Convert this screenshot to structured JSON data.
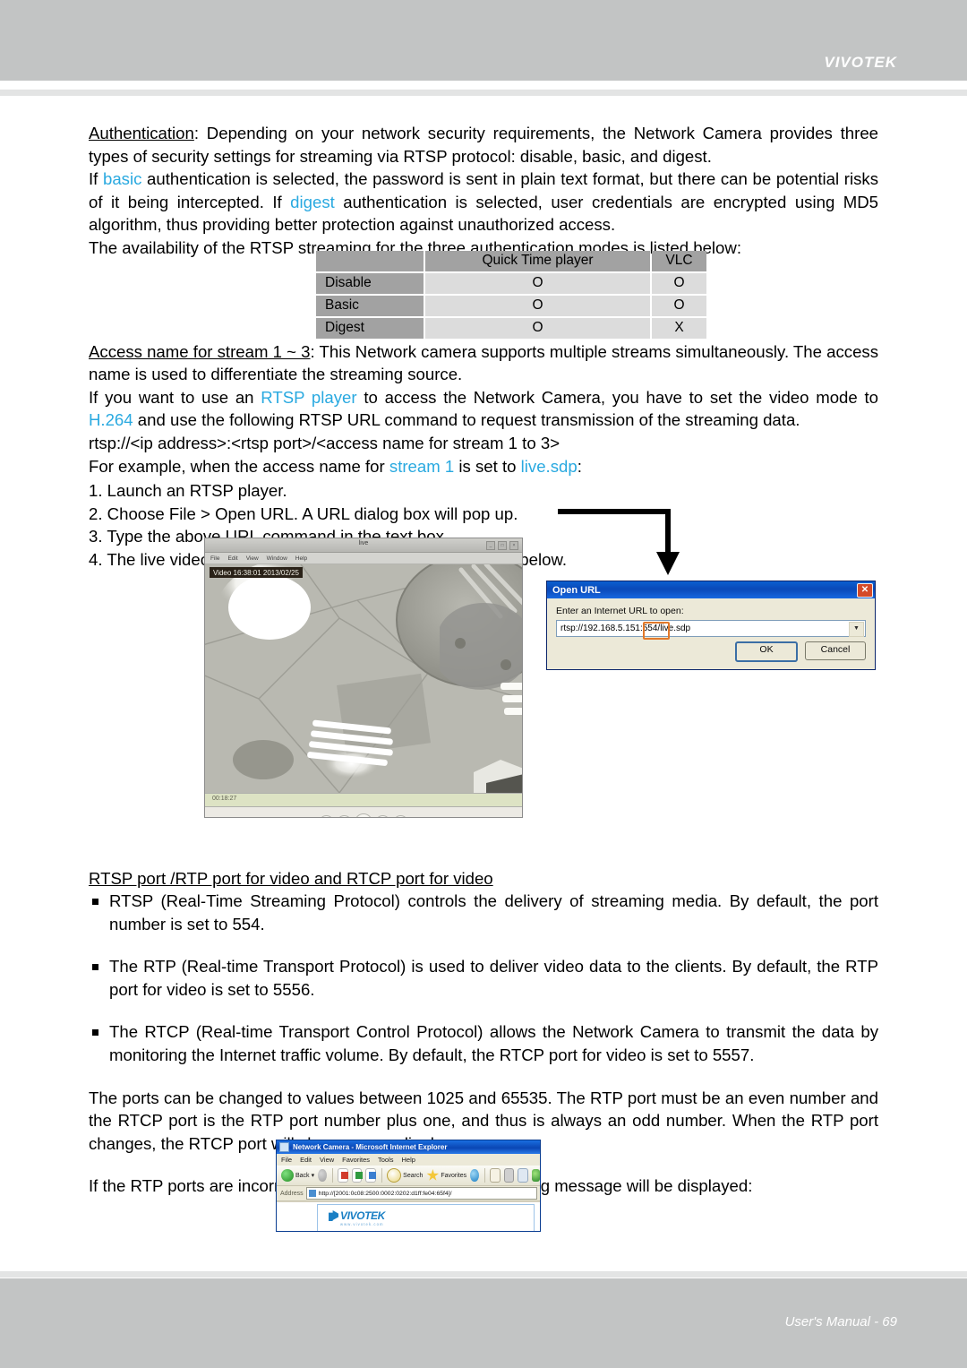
{
  "header": {
    "brand": "VIVOTEK"
  },
  "footer": {
    "text": "User's Manual - 69"
  },
  "body": {
    "auth_heading": "Authentication",
    "auth_p1_rest": ": Depending on your network security requirements, the Network Camera provides three types of security settings for streaming via RTSP protocol: disable, basic, and digest.",
    "auth_p2_a": "If ",
    "auth_p2_basic": "basic",
    "auth_p2_b": " authentication is selected, the password is sent in plain text format, but there can be potential risks of it being intercepted. If ",
    "auth_p2_digest": "digest",
    "auth_p2_c": " authentication is selected, user credentials are encrypted using MD5 algorithm, thus providing better protection against unauthorized access.",
    "auth_p3": "The availability of the RTSP streaming for the three authentication modes is listed below:",
    "access_heading": "Access name for stream 1 ~ 3",
    "access_p1_rest": ": This Network camera supports multiple streams simultaneously. The access name is used to differentiate the streaming source.",
    "access_p2_a": "If you want to use an ",
    "access_p2_rtsp": "RTSP player",
    "access_p2_b": " to access the Network Camera, you have to set the video mode to ",
    "access_p2_h264": "H.264",
    "access_p2_c": " and use the following RTSP URL command to request transmission of the streaming data.",
    "access_url": "rtsp://<ip address>:<rtsp port>/<access name for stream 1 to 3>",
    "access_p3_a": "For example, when the access name for ",
    "access_p3_stream": "stream 1",
    "access_p3_b": " is set to ",
    "access_p3_livesdp": "live.sdp",
    "access_p3_c": ":",
    "ports_heading": "RTSP port /RTP port for video and RTCP port for video",
    "bullet_rtsp": "RTSP (Real-Time Streaming Protocol) controls the delivery of streaming media. By default, the port number is set to 554.",
    "bullet_rtp": "The RTP (Real-time Transport Protocol) is used to deliver video data to the clients. By default, the RTP port for video is set to 5556.",
    "bullet_rtcp": "The RTCP (Real-time Transport Control Protocol) allows the Network Camera to transmit the data by monitoring the Internet traffic volume. By default, the RTCP port for video is set to 5557.",
    "ports_range_p": "The ports can be changed to values between 1025 and 65535. The RTP port must be an even number and the RTCP port is the RTP port number plus one, and thus is always an odd number. When the RTP port changes, the RTCP port will change accordingly.",
    "warning_p": "If the RTP ports are incorrectly assigned, the following warning message will be displayed:"
  },
  "steps": [
    "1. Launch an RTSP player.",
    "2. Choose File > Open URL. A URL dialog box will pop up.",
    "3. Type the above URL command in the text box.",
    "4. The live video will be displayed in your player as shown below."
  ],
  "availability_table": {
    "columns": [
      "",
      "Quick Time player",
      "VLC"
    ],
    "rows": [
      {
        "mode": "Disable",
        "quicktime": "O",
        "vlc": "O"
      },
      {
        "mode": "Basic",
        "quicktime": "O",
        "vlc": "O"
      },
      {
        "mode": "Digest",
        "quicktime": "O",
        "vlc": "X"
      }
    ]
  },
  "quicktime_player": {
    "window_title": "live",
    "menus": [
      "File",
      "Edit",
      "View",
      "Window",
      "Help"
    ],
    "osd_text": "Video 16:38:01 2013/02/25",
    "scrub_time": "00:18:27",
    "controls": [
      "skip-back",
      "rewind",
      "pause",
      "fast-forward",
      "skip-forward"
    ],
    "min_label": "_",
    "max_label": "□",
    "close_label": "×"
  },
  "open_url_dialog": {
    "title": "Open URL",
    "close_label": "✕",
    "prompt": "Enter an Internet URL to open:",
    "url_value": "rtsp://192.168.5.151:554/live.sdp",
    "dropdown_glyph": "▼",
    "ok_label": "OK",
    "cancel_label": "Cancel"
  },
  "ie_window": {
    "title": "Network Camera - Microsoft Internet Explorer",
    "menus": [
      "File",
      "Edit",
      "View",
      "Favorites",
      "Tools",
      "Help"
    ],
    "toolbar": {
      "back_label": "Back",
      "back_caret": "▾",
      "search_label": "Search",
      "favorites_label": "Favorites"
    },
    "address_label": "Address",
    "address_url": "http://[2001:0c08:2500:0002:0202:d1ff:fe04:65f4]/",
    "page_logo": "VIVOTEK",
    "page_logo_sub": "www.vivotek.com"
  },
  "colors": {
    "band": "#c2c4c4",
    "accent_cyan": "#29a9e0",
    "table_header": "#a2a2a2",
    "table_cell": "#dcdcdc",
    "highlight_orange": "#e2792a",
    "xp_blue": "#0a49b8",
    "vivotek_blue": "#1a7fc4"
  }
}
